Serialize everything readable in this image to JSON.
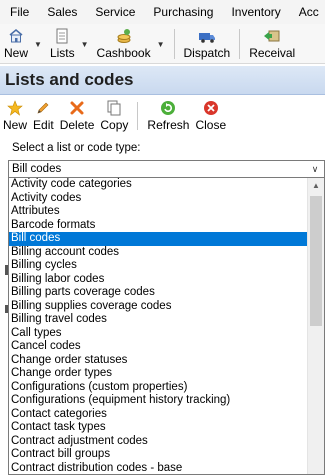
{
  "menubar": {
    "items": [
      "File",
      "Sales",
      "Service",
      "Purchasing",
      "Inventory",
      "Acc"
    ]
  },
  "toolbar": {
    "new_label": "New",
    "lists_label": "Lists",
    "cashbook_label": "Cashbook",
    "dispatch_label": "Dispatch",
    "receivals_label": "Receival"
  },
  "panel": {
    "title": "Lists and codes"
  },
  "panel_toolbar": {
    "new_label": "New",
    "edit_label": "Edit",
    "delete_label": "Delete",
    "copy_label": "Copy",
    "refresh_label": "Refresh",
    "close_label": "Close"
  },
  "selector": {
    "label": "Select a list or code type:",
    "value": "Bill codes",
    "options": [
      "Activity code categories",
      "Activity codes",
      "Attributes",
      "Barcode formats",
      "Bill codes",
      "Billing account codes",
      "Billing cycles",
      "Billing labor codes",
      "Billing parts coverage codes",
      "Billing supplies coverage codes",
      "Billing travel codes",
      "Call types",
      "Cancel codes",
      "Change order statuses",
      "Change order types",
      "Configurations (custom properties)",
      "Configurations (equipment history tracking)",
      "Contact categories",
      "Contact task types",
      "Contract adjustment codes",
      "Contract bill groups",
      "Contract distribution codes - base"
    ],
    "selected_index": 4
  },
  "colors": {
    "selection": "#0078d7",
    "header_bg": "#c9d9ef"
  }
}
